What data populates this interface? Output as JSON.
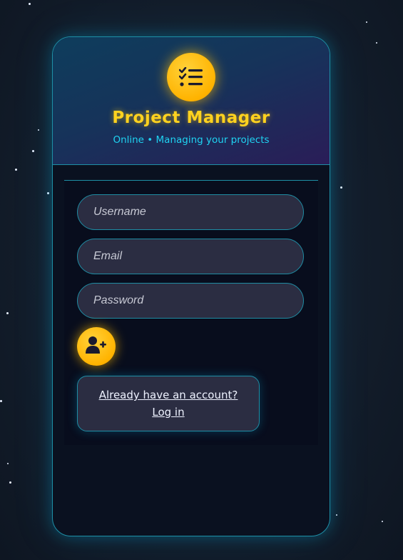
{
  "app": {
    "title": "Project Manager",
    "subtitle": "Online • Managing your projects"
  },
  "form": {
    "username_placeholder": "Username",
    "email_placeholder": "Email",
    "password_placeholder": "Password",
    "submit_icon": "user-plus-icon"
  },
  "login_link": {
    "line1": "Already have an account?",
    "line2": "Log in"
  },
  "icons": {
    "logo": "checklist-icon"
  },
  "colors": {
    "accent": "#ffc20a",
    "cyan": "#1fd3f2",
    "border": "#1f8ca3",
    "card_bg": "#0a1120"
  }
}
